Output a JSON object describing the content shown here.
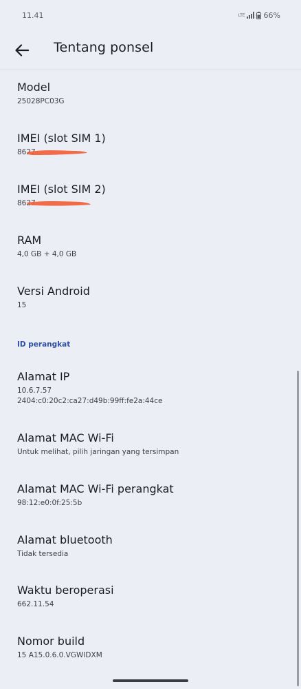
{
  "status_bar": {
    "time": "11.41",
    "network": "LTE",
    "battery": "66%"
  },
  "app_bar": {
    "title": "Tentang ponsel",
    "back_icon": "arrow-back-icon"
  },
  "items_top": [
    {
      "title": "Model",
      "subtitle": "25028PC03G"
    },
    {
      "title": "IMEI (slot SIM 1)",
      "subtitle": "8627"
    },
    {
      "title": "IMEI (slot SIM 2)",
      "subtitle": "8627"
    },
    {
      "title": "RAM",
      "subtitle": "4,0 GB + 4,0 GB"
    },
    {
      "title": "Versi Android",
      "subtitle": "15"
    }
  ],
  "section": {
    "label": "ID perangkat"
  },
  "items_device": [
    {
      "title": "Alamat IP",
      "subtitle": "10.6.7.57",
      "subtitle2": "2404:c0:20c2:ca27:d49b:99ff:fe2a:44ce"
    },
    {
      "title": "Alamat MAC Wi-Fi",
      "subtitle": "Untuk melihat, pilih jaringan yang tersimpan"
    },
    {
      "title": "Alamat MAC Wi-Fi perangkat",
      "subtitle": "98:12:e0:0f:25:5b"
    },
    {
      "title": "Alamat bluetooth",
      "subtitle": "Tidak tersedia"
    },
    {
      "title": "Waktu beroperasi",
      "subtitle": "662.11.54"
    },
    {
      "title": "Nomor build",
      "subtitle": "15 A15.0.6.0.VGWIDXM"
    }
  ],
  "colors": {
    "background": "#eceef6",
    "accent": "#2f50a6",
    "redaction": "#f2603a"
  }
}
